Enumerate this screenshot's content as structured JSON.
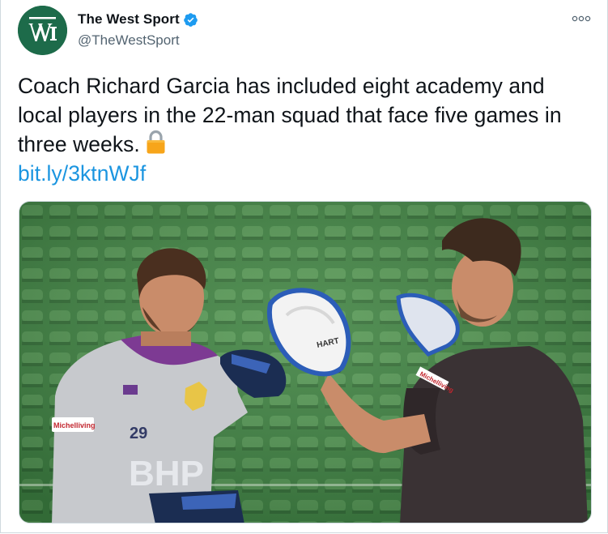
{
  "account": {
    "display_name": "The West Sport",
    "handle": "@TheWestSport",
    "verified": true,
    "avatar_letters": "W",
    "avatar_color": "#1d6b4a"
  },
  "tweet": {
    "text": "Coach Richard Garcia has included eight academy and local players in the 22-man squad that face five games in three weeks.",
    "link_text": "bit.ly/3ktnWJf",
    "emoji_icon": "lock-icon"
  },
  "media": {
    "description_icon": "photo",
    "sponsor_text": "Michelliving.",
    "jersey_number": "29",
    "shirt_print": "BHP",
    "pad_brand": "HART"
  },
  "colors": {
    "text": "#0f1419",
    "secondary": "#536471",
    "link": "#1b95e0",
    "verified": "#1d9bf0"
  }
}
